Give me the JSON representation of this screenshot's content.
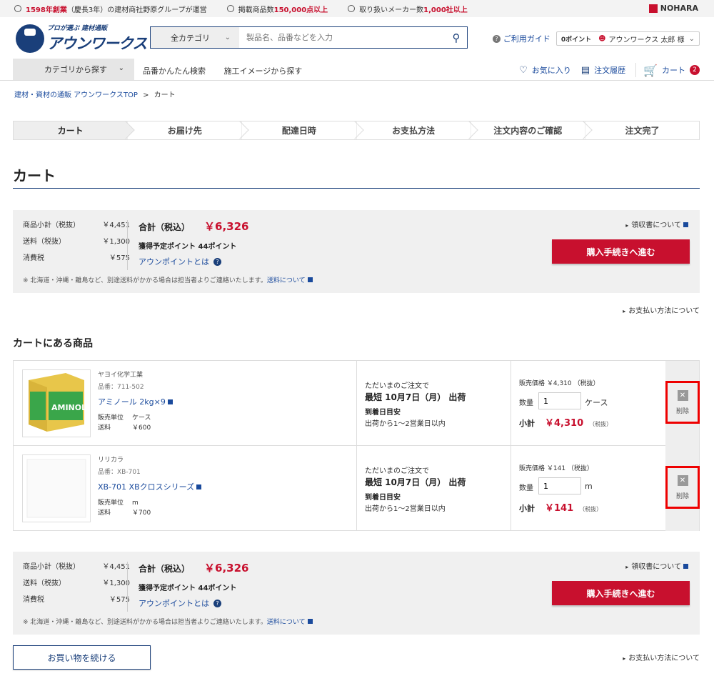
{
  "topstrip": {
    "items": [
      {
        "pre": "",
        "bold": "1598年創業",
        "post": "（慶長3年）の建材商社野原グループが運営"
      },
      {
        "pre": "掲載商品数",
        "bold": "150,000点以上",
        "post": ""
      },
      {
        "pre": "取り扱いメーカー数",
        "bold": "1,000社以上",
        "post": ""
      }
    ],
    "brand": "NOHARA"
  },
  "logo": {
    "sub": "プロが選ぶ 建材通販",
    "main": "アウンワークス"
  },
  "search": {
    "category": "全カテゴリ",
    "placeholder": "製品名、品番などを入力"
  },
  "util": {
    "guide": "ご利用ガイド",
    "points": "0ポイント",
    "user": "アウンワークス 太郎 様"
  },
  "nav": {
    "category_button": "カテゴリから探す",
    "links": [
      "品番かんたん検索",
      "施工イメージから探す"
    ],
    "favorites": "お気に入り",
    "history": "注文履歴",
    "cart": "カート",
    "cart_count": "2"
  },
  "breadcrumb": {
    "home": "建材・資材の通販 アウンワークスTOP",
    "sep": ">",
    "current": "カート"
  },
  "steps": [
    "カート",
    "お届け先",
    "配達日時",
    "お支払方法",
    "注文内容のご確認",
    "注文完了"
  ],
  "page_title": "カート",
  "summary": {
    "rows": [
      {
        "label": "商品小計（税抜）",
        "value": "￥4,451"
      },
      {
        "label": "送料（税抜）",
        "value": "￥1,300"
      },
      {
        "label": "消費税",
        "value": "￥575"
      }
    ],
    "total_label": "合計（税込）",
    "total_value": "￥6,326",
    "points": "獲得予定ポイント 44ポイント",
    "about_points": "アウンポイントとは",
    "note": "※ 北海道・沖縄・離島など、別途送料がかかる場合は担当者よりご連絡いたします。",
    "shipping_link": "送料について",
    "receipt": "領収書について",
    "buy_button": "購入手続きへ進む"
  },
  "payment_link": "お支払い方法について",
  "section_title": "カートにある商品",
  "items": [
    {
      "maker": "ヤヨイ化学工業",
      "code": "品番：711-502",
      "name": "アミノール 2kg×9",
      "unit_label": "販売単位",
      "unit": "ケース",
      "ship_label": "送料",
      "ship": "￥600",
      "delivery_line1": "ただいまのご注文で",
      "delivery_line2": "最短 10月7日（月） 出荷",
      "delivery_line3": "到着日目安",
      "delivery_line4": "出荷から1～2営業日以内",
      "price": "販売価格 ￥4,310 （税抜）",
      "qty_label": "数量",
      "qty": "1",
      "qty_unit": "ケース",
      "subtotal_label": "小計",
      "subtotal": "￥4,310",
      "tax_note": "（税抜）",
      "delete": "削除"
    },
    {
      "maker": "リリカラ",
      "code": "品番：XB-701",
      "name": "XB-701 XBクロスシリーズ",
      "unit_label": "販売単位",
      "unit": "m",
      "ship_label": "送料",
      "ship": "￥700",
      "delivery_line1": "ただいまのご注文で",
      "delivery_line2": "最短 10月7日（月） 出荷",
      "delivery_line3": "到着日目安",
      "delivery_line4": "出荷から1～2営業日以内",
      "price": "販売価格 ￥141 （税抜）",
      "qty_label": "数量",
      "qty": "1",
      "qty_unit": "m",
      "subtotal_label": "小計",
      "subtotal": "￥141",
      "tax_note": "（税抜）",
      "delete": "削除"
    }
  ],
  "continue_button": "お買い物を続ける",
  "colors": {
    "accent": "#c8102e",
    "brand": "#1a3f7a",
    "link": "#1a4a9c"
  }
}
